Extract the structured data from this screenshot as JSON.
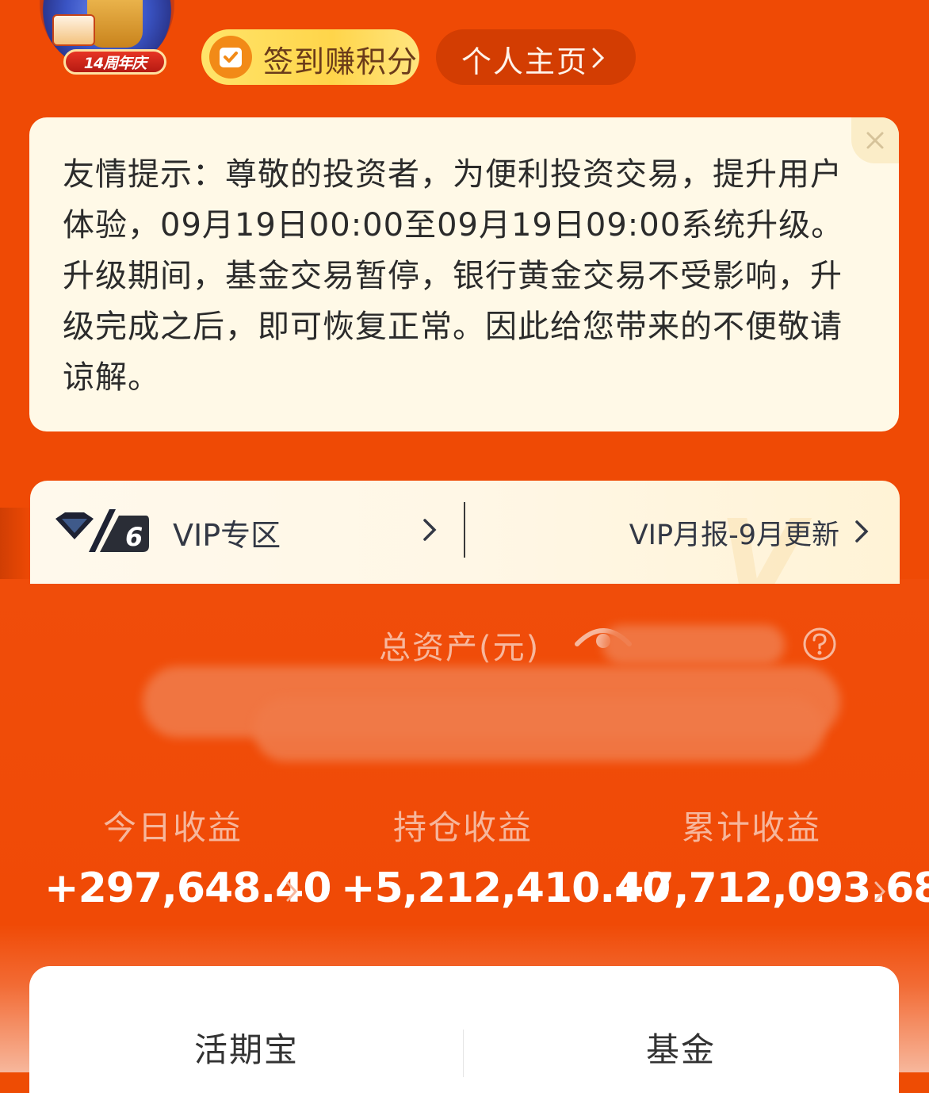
{
  "colors": {
    "background": "#ef4a05",
    "notice_bg": "#fff9e7",
    "checkin_bg": "#ffd54a",
    "profile_bg": "#d33d02",
    "stat_label": "#f6b69c"
  },
  "header": {
    "avatar_badge": "14周年庆",
    "checkin_label": "签到赚积分",
    "profile_label": "个人主页"
  },
  "notice": {
    "text": "友情提示：尊敬的投资者，为便利投资交易，提升用户体验，09月19日00:00至09月19日09:00系统升级。升级期间，基金交易暂停，银行黄金交易不受影响，升级完成之后，即可恢复正常。因此给您带来的不便敬请谅解。",
    "close_icon": "close-icon"
  },
  "vip": {
    "level": "6",
    "zone_label": "VIP专区",
    "report_label": "VIP月报-9月更新"
  },
  "assets": {
    "total_label": "总资产(元)",
    "stats": [
      {
        "label": "今日收益",
        "value": "+297,648.40"
      },
      {
        "label": "持仓收益",
        "value": "+5,212,410.40"
      },
      {
        "label": "累计收益",
        "value": "+7,712,093.68"
      }
    ]
  },
  "tabs": [
    {
      "label": "活期宝"
    },
    {
      "label": "基金"
    }
  ]
}
